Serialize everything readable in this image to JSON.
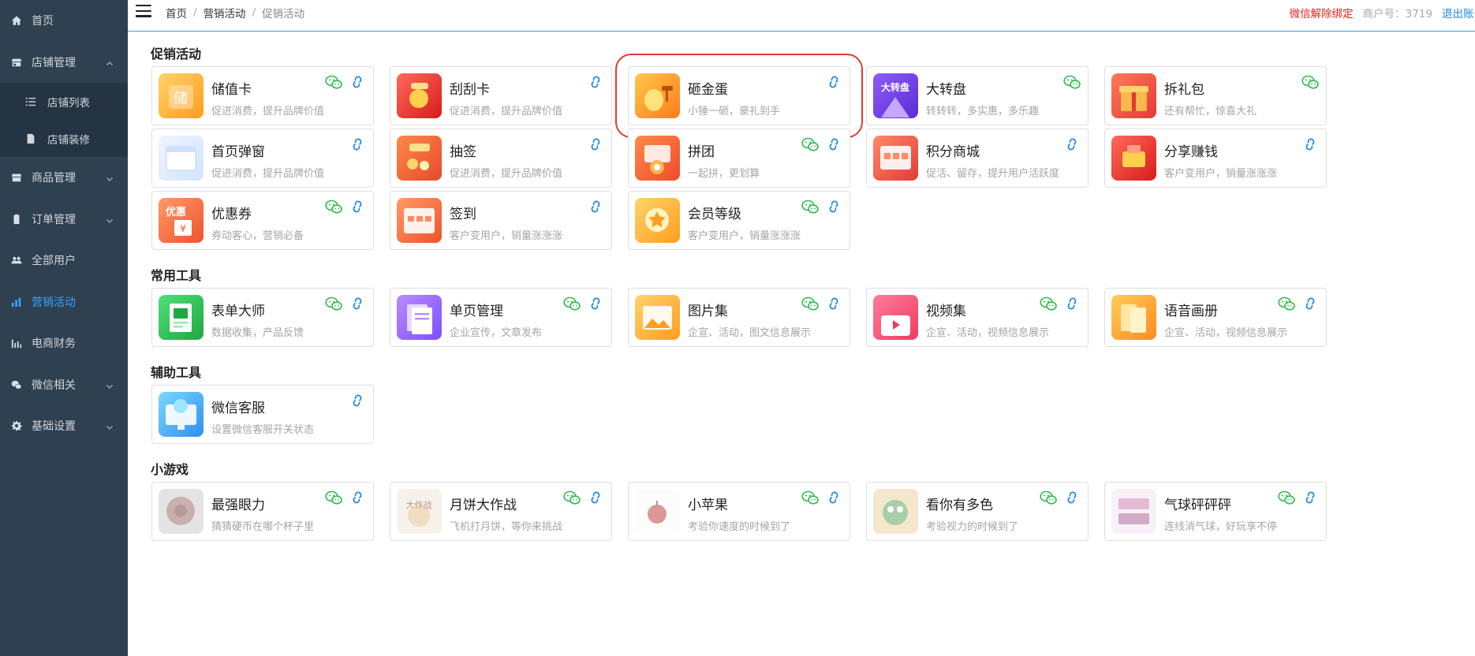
{
  "sidebar": {
    "items": [
      {
        "key": "home",
        "label": "首页",
        "icon": "home-icon",
        "chevron": false,
        "active": false
      },
      {
        "key": "shop",
        "label": "店铺管理",
        "icon": "shop-icon",
        "chevron": "up",
        "active": false,
        "children": [
          {
            "label": "店铺列表",
            "icon": "list-icon"
          },
          {
            "label": "店铺装修",
            "icon": "document-icon"
          }
        ]
      },
      {
        "key": "goods",
        "label": "商品管理",
        "icon": "goods-icon",
        "chevron": "down",
        "active": false
      },
      {
        "key": "orders",
        "label": "订单管理",
        "icon": "clipboard-icon",
        "chevron": "down",
        "active": false
      },
      {
        "key": "users",
        "label": "全部用户",
        "icon": "users-icon",
        "chevron": false,
        "active": false
      },
      {
        "key": "marketing",
        "label": "营销活动",
        "icon": "bar-chart-icon",
        "chevron": false,
        "active": true
      },
      {
        "key": "finance",
        "label": "电商财务",
        "icon": "finance-chart-icon",
        "chevron": false,
        "active": false
      },
      {
        "key": "wechat",
        "label": "微信相关",
        "icon": "wechat-icon",
        "chevron": "down",
        "active": false
      },
      {
        "key": "settings",
        "label": "基础设置",
        "icon": "gear-icon",
        "chevron": "down",
        "active": false
      }
    ]
  },
  "header": {
    "breadcrumb": [
      "首页",
      "营销活动",
      "促销活动"
    ],
    "unbind_wechat": "微信解除绑定",
    "merchant": "商户号：3719",
    "logout": "退出账号"
  },
  "sections": [
    {
      "title": "促销活动",
      "cards": [
        {
          "title": "储值卡",
          "desc": "促进消费，提升品牌价值",
          "icon": "stored-value-card-icon",
          "wechat": true,
          "link": true
        },
        {
          "title": "刮刮卡",
          "desc": "促进消费，提升品牌价值",
          "icon": "scratch-card-icon",
          "wechat": false,
          "link": true
        },
        {
          "title": "砸金蛋",
          "desc": "小锤一砸，豪礼到手",
          "icon": "golden-egg-icon",
          "wechat": false,
          "link": true,
          "highlighted": true
        },
        {
          "title": "大转盘",
          "desc": "转转转，多实惠，多乐趣",
          "icon": "lucky-wheel-icon",
          "wechat": true,
          "link": false
        },
        {
          "title": "拆礼包",
          "desc": "还有帮忙，惊喜大礼",
          "icon": "gift-box-icon",
          "wechat": true,
          "link": false
        },
        {
          "title": "首页弹窗",
          "desc": "促进消费，提升品牌价值",
          "icon": "popup-window-icon",
          "wechat": false,
          "link": true
        },
        {
          "title": "抽签",
          "desc": "促进消费，提升品牌价值",
          "icon": "lottery-draw-icon",
          "wechat": false,
          "link": true
        },
        {
          "title": "拼团",
          "desc": "一起拼，更划算",
          "icon": "group-buy-icon",
          "wechat": true,
          "link": true
        },
        {
          "title": "积分商城",
          "desc": "促活、留存，提升用户活跃度",
          "icon": "points-mall-icon",
          "wechat": false,
          "link": true
        },
        {
          "title": "分享赚钱",
          "desc": "客户变用户，销量涨涨涨",
          "icon": "share-earn-icon",
          "wechat": false,
          "link": true
        },
        {
          "title": "优惠券",
          "desc": "券动客心，营销必备",
          "icon": "coupon-icon",
          "wechat": true,
          "link": true
        },
        {
          "title": "签到",
          "desc": "客户变用户，销量涨涨涨",
          "icon": "check-in-icon",
          "wechat": false,
          "link": true
        },
        {
          "title": "会员等级",
          "desc": "客户变用户，销量涨涨涨",
          "icon": "member-level-icon",
          "wechat": true,
          "link": true
        }
      ]
    },
    {
      "title": "常用工具",
      "cards": [
        {
          "title": "表单大师",
          "desc": "数据收集，产品反馈",
          "icon": "form-master-icon",
          "wechat": true,
          "link": true
        },
        {
          "title": "单页管理",
          "desc": "企业宣传，文章发布",
          "icon": "single-page-icon",
          "wechat": true,
          "link": true
        },
        {
          "title": "图片集",
          "desc": "企宣、活动，图文信息展示",
          "icon": "image-gallery-icon",
          "wechat": true,
          "link": true
        },
        {
          "title": "视频集",
          "desc": "企宣、活动，视频信息展示",
          "icon": "video-collection-icon",
          "wechat": true,
          "link": true
        },
        {
          "title": "语音画册",
          "desc": "企宣、活动，视频信息展示",
          "icon": "voice-album-icon",
          "wechat": true,
          "link": true
        }
      ]
    },
    {
      "title": "辅助工具",
      "cards": [
        {
          "title": "微信客服",
          "desc": "设置微信客服开关状态",
          "icon": "wechat-service-icon",
          "wechat": false,
          "link": true
        }
      ]
    },
    {
      "title": "小游戏",
      "cards": [
        {
          "title": "最强眼力",
          "desc": "猜猜硬币在哪个杯子里",
          "icon": "sharp-eye-game-icon",
          "wechat": true,
          "link": true,
          "faded": true
        },
        {
          "title": "月饼大作战",
          "desc": "飞机打月饼，等你来挑战",
          "icon": "mooncake-battle-game-icon",
          "wechat": true,
          "link": true,
          "faded": true
        },
        {
          "title": "小苹果",
          "desc": "考验你速度的时候到了",
          "icon": "apple-game-icon",
          "wechat": true,
          "link": true,
          "faded": true
        },
        {
          "title": "看你有多色",
          "desc": "考验视力的时候到了",
          "icon": "color-test-game-icon",
          "wechat": true,
          "link": true,
          "faded": true
        },
        {
          "title": "气球砰砰砰",
          "desc": "连线消气球，好玩享不停",
          "icon": "balloon-pop-game-icon",
          "wechat": true,
          "link": true,
          "faded": true
        }
      ]
    }
  ],
  "colors": {
    "sidebar_bg": "#2f4050",
    "active_blue": "#3aa0ff",
    "unbind_red": "#e2231a",
    "wechat_green": "#2dbb4a",
    "link_blue": "#1e88e5",
    "highlight_red": "#e53935"
  }
}
